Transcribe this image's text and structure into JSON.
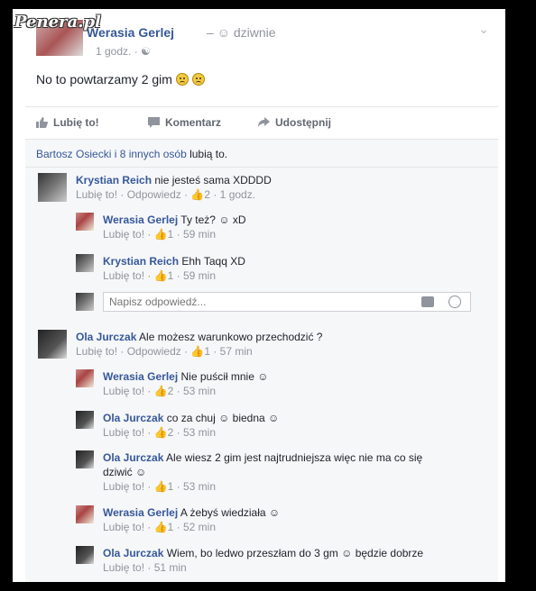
{
  "watermark": "Penera.pl",
  "post": {
    "author": "Werasia Gerlej",
    "feeling": "– ☺ dziwnie",
    "time": "1 godz. ·",
    "text": "No to powtarzamy 2 gim"
  },
  "actions": {
    "like": "Lubię to!",
    "comment": "Komentarz",
    "share": "Udostępnij"
  },
  "likes": {
    "names": "Bartosz Osiecki i 8 innych osób",
    "suffix": "lubią to."
  },
  "comments": [
    {
      "name": "Krystian Reich",
      "text": "nie jesteś sama XDDDD",
      "meta": "Lubię to! · Odpowiedz · 👍2 · 1 godz."
    },
    {
      "name": "Werasia Gerlej",
      "text": "Ty też? ☺ xD",
      "meta": "Lubię to! · 👍1 · 59 min"
    },
    {
      "name": "Krystian Reich",
      "text": "Ehh Taqq XD",
      "meta": "Lubię to! · 👍1 · 59 min"
    },
    {
      "name": "Ola Jurczak",
      "text": "Ale możesz warunkowo przechodzić ?",
      "meta": "Lubię to! · Odpowiedz · 👍1 · 57 min"
    },
    {
      "name": "Werasia Gerlej",
      "text": "Nie puścił mnie ☺",
      "meta": "Lubię to! · 👍2 · 53 min"
    },
    {
      "name": "Ola Jurczak",
      "text": "co za chuj ☺ biedna ☺",
      "meta": "Lubię to! · 👍2 · 53 min"
    },
    {
      "name": "Ola Jurczak",
      "text": "Ale wiesz 2 gim jest najtrudniejsza więc nie ma co się",
      "text2": "dziwić ☺",
      "meta": "Lubię to! · 👍1 · 53 min"
    },
    {
      "name": "Werasia Gerlej",
      "text": "A żebyś wiedziała ☺",
      "meta": "Lubię to! · 👍1 · 52 min"
    },
    {
      "name": "Ola Jurczak",
      "text": "Wiem, bo ledwo przeszłam do 3 gm ☺ będzie dobrze",
      "meta": "Lubię to! · 51 min"
    }
  ],
  "reply": {
    "placeholder": "Napisz odpowiedź..."
  }
}
